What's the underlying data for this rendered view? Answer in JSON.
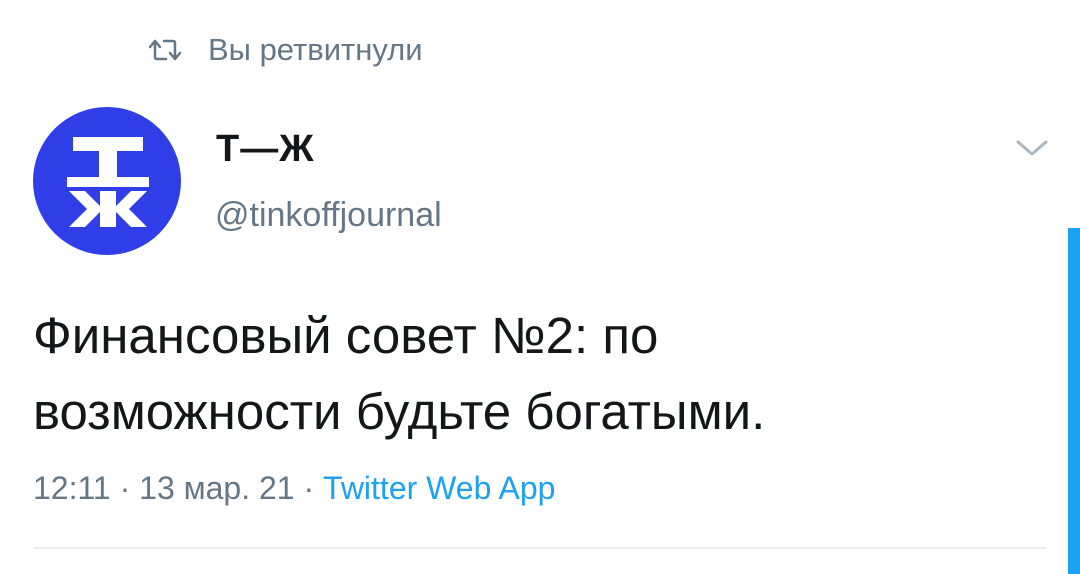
{
  "retweet_notice": {
    "icon": "retweet-icon",
    "text": "Вы ретвитнули"
  },
  "author": {
    "avatar_letters_top": "Т",
    "avatar_letters_bottom": "Ж",
    "avatar_color": "#2f3ee6",
    "display_name": "Т—Ж",
    "handle": "@tinkoffjournal"
  },
  "tweet": {
    "text_line1": "Финансовый совет №2: по",
    "text_line2": "возможности будьте богатыми."
  },
  "meta": {
    "time": "12:11",
    "separator1": " · ",
    "date": "13 мар. 21",
    "separator2": " · ",
    "source": "Twitter Web App"
  },
  "menu": {
    "icon": "chevron-down-icon"
  },
  "colors": {
    "secondary_text": "#657786",
    "link": "#1da1f2",
    "divider": "#e6ecf0"
  }
}
